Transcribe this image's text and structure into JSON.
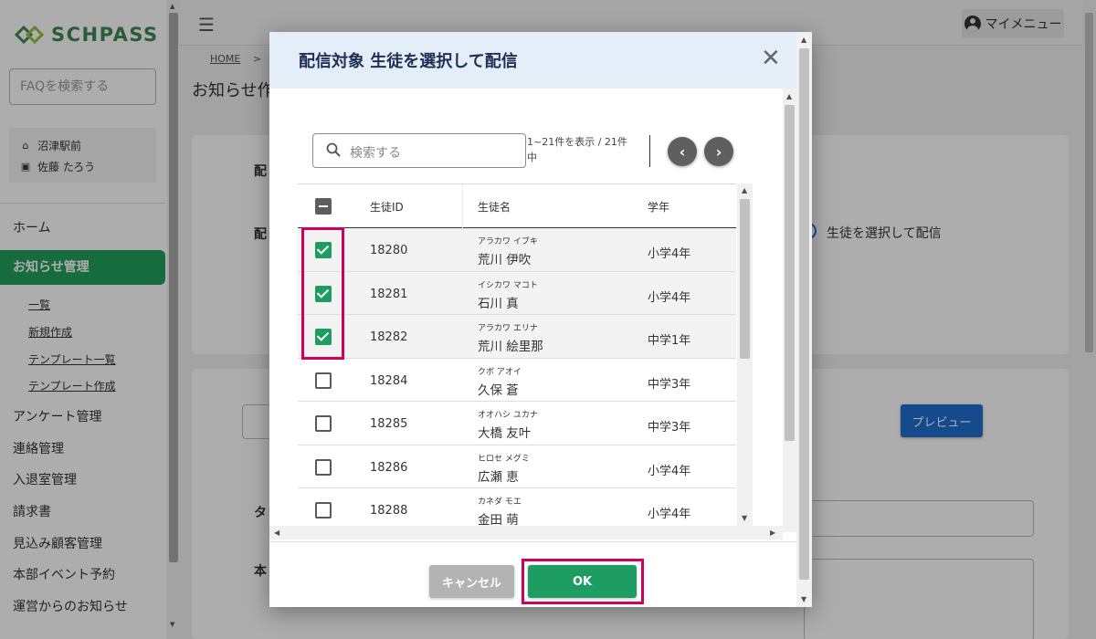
{
  "sidebar": {
    "logo_text": "SCHPASS",
    "faq_placeholder": "FAQを検索する",
    "school_name": "沼津駅前",
    "user_name": "佐藤 たろう",
    "nav": [
      "ホーム",
      "お知らせ管理",
      "アンケート管理",
      "連絡管理",
      "入退室管理",
      "請求書",
      "見込み顧客管理",
      "本部イベント予約",
      "運営からのお知らせ"
    ],
    "subnav": [
      "一覧",
      "新規作成",
      "テンプレート一覧",
      "テンプレート作成"
    ]
  },
  "header": {
    "my_menu": "マイメニュー",
    "breadcrumb_home": "HOME",
    "breadcrumb_sep": ">",
    "page_title": "お知らせ作",
    "radio_text": "生徒を選択して配信",
    "preview": "プレビュー"
  },
  "modal": {
    "title": "配信対象 生徒を選択して配信",
    "search_placeholder": "検索する",
    "range_text": "1~21件を表示 / 21件中",
    "columns": {
      "id": "生徒ID",
      "name": "生徒名",
      "grade": "学年"
    },
    "rows": [
      {
        "id": "18280",
        "kana": "アラカワ イブキ",
        "name": "荒川 伊吹",
        "grade": "小学4年",
        "checked": true
      },
      {
        "id": "18281",
        "kana": "イシカワ マコト",
        "name": "石川 真",
        "grade": "小学4年",
        "checked": true
      },
      {
        "id": "18282",
        "kana": "アラカワ エリナ",
        "name": "荒川 絵里那",
        "grade": "中学1年",
        "checked": true
      },
      {
        "id": "18284",
        "kana": "クボ アオイ",
        "name": "久保 蒼",
        "grade": "中学3年",
        "checked": false
      },
      {
        "id": "18285",
        "kana": "オオハシ ユカナ",
        "name": "大橋 友叶",
        "grade": "中学3年",
        "checked": false
      },
      {
        "id": "18286",
        "kana": "ヒロセ メグミ",
        "name": "広瀬 恵",
        "grade": "小学4年",
        "checked": false
      },
      {
        "id": "18288",
        "kana": "カネダ モエ",
        "name": "金田 萌",
        "grade": "小学4年",
        "checked": false
      }
    ],
    "cancel": "キャンセル",
    "ok": "OK"
  },
  "colors": {
    "accent_green": "#1e9d63",
    "highlight": "#d1005d",
    "header_bg": "#e4eef8",
    "title_color": "#1e2f55"
  }
}
